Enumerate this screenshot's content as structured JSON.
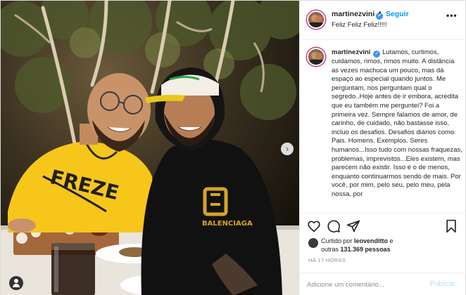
{
  "post": {
    "username": "martinezvini",
    "verified_icon": "verified-badge-icon",
    "separator": "•",
    "follow_label": "Seguir",
    "subtitle": "Feliz Feliz Feliz!!!!!",
    "more_icon": "more-options-icon",
    "more_glyph": "•••"
  },
  "photo": {
    "next_icon": "chevron-right-icon",
    "next_glyph": "›",
    "tag_icon": "user-tag-icon",
    "shirt_left_text": "FREZE",
    "shirt_right_text": "BALENCIAGA"
  },
  "caption": {
    "username": "martinezvini",
    "text": "Lutamos, curtimos, cuidamos, rimos, rimos muito. A distância as vezes machuca um pouco, mas dá espaço ao especial quando juntos. Me perguntam, nos perguntam qual o segredo..Hoje antes de ir embora, acredita que eu também me perguntei? Foi a primeira vez. Sempre falamos de amor, de carinho, de cuidado, não bastasse isso, incluo os desafios. Desafios diários como Pais. Homens. Exemplos. Seres humanos...Isso tudo com nossas fraquezas, problemas, imprevistos...Eles existem, mas parecem não existir. Isso é o de menos, enquanto continuarmos sendo de mais. Por você, por mim, pelo seu, pelo meu, pela nossa, por"
  },
  "actions": {
    "heart_icon": "heart-icon",
    "comment_icon": "comment-icon",
    "share_icon": "share-icon",
    "save_icon": "bookmark-icon"
  },
  "likes": {
    "prefix": "Curtido por ",
    "user": "leovenditto",
    "connector": " e",
    "others_prefix": "outras ",
    "others_count": "131.369 pessoas"
  },
  "timestamp": "HÁ 17 HORAS",
  "comment": {
    "placeholder": "Adicione um comentário...",
    "publish_label": "Publicar"
  },
  "colors": {
    "accent": "#0095f6",
    "verified": "#3897f0",
    "publish_disabled": "#b2dffc",
    "muted": "#8e8e8e",
    "text": "#262626"
  }
}
